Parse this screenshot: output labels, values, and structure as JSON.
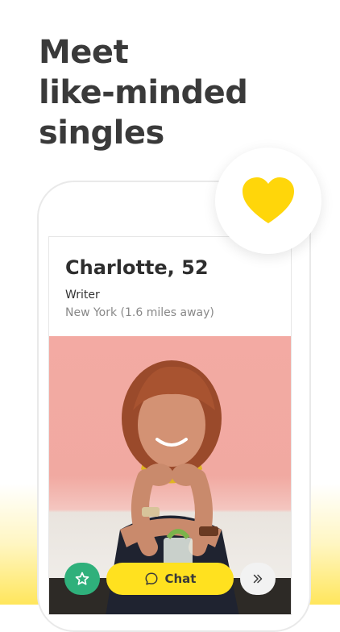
{
  "headline": {
    "line1": "Meet",
    "line2": "like-minded",
    "line3": "singles"
  },
  "profile": {
    "name_age": "Charlotte, 52",
    "occupation": "Writer",
    "location": "New York (1.6 miles away)"
  },
  "actions": {
    "favorite_icon": "star-icon",
    "chat_icon": "chat-bubble-icon",
    "chat_label": "Chat",
    "skip_icon": "double-chevron-right-icon"
  },
  "colors": {
    "accent_yellow": "#ffe11f",
    "heart_yellow": "#ffd60a",
    "favorite_green": "#2fb07b",
    "text_dark": "#3a3a3a"
  }
}
